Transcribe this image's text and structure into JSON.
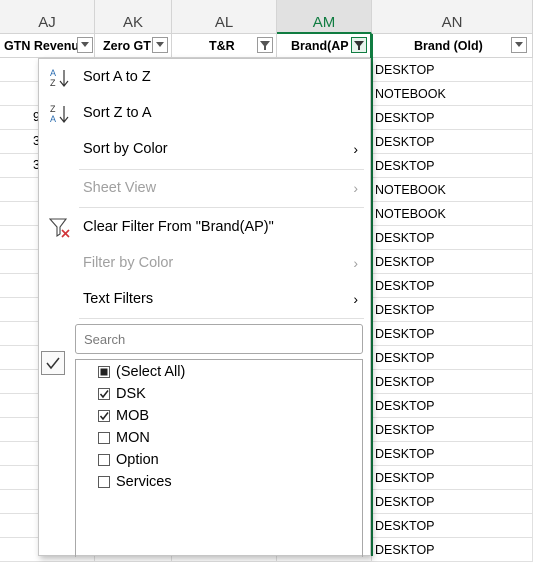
{
  "columns": [
    {
      "letter": "AJ",
      "header": "GTN Revenu",
      "active": false
    },
    {
      "letter": "AK",
      "header": "Zero GT",
      "active": false
    },
    {
      "letter": "AL",
      "header": "T&R",
      "active": false
    },
    {
      "letter": "AM",
      "header": "Brand(AP",
      "active": true
    },
    {
      "letter": "AN",
      "header": "Brand (Old)",
      "active": false
    }
  ],
  "brand_old_values": [
    "DESKTOP",
    "NOTEBOOK",
    "DESKTOP",
    "DESKTOP",
    "DESKTOP",
    "NOTEBOOK",
    "NOTEBOOK",
    "DESKTOP",
    "DESKTOP",
    "DESKTOP",
    "DESKTOP",
    "DESKTOP",
    "DESKTOP",
    "DESKTOP",
    "DESKTOP",
    "DESKTOP",
    "DESKTOP",
    "DESKTOP",
    "DESKTOP",
    "DESKTOP",
    "DESKTOP"
  ],
  "aj_fragments": [
    "9",
    "3",
    "3"
  ],
  "menu": {
    "sort_az": "Sort A to Z",
    "sort_za": "Sort Z to A",
    "sort_by_color": "Sort by Color",
    "sheet_view": "Sheet View",
    "clear_filter": "Clear Filter From \"Brand(AP)\"",
    "filter_by_color": "Filter by Color",
    "text_filters": "Text Filters",
    "chevron": "›",
    "search_placeholder": "Search",
    "items": [
      {
        "label": "(Select All)",
        "state": "partial"
      },
      {
        "label": "DSK",
        "state": "checked"
      },
      {
        "label": "MOB",
        "state": "checked"
      },
      {
        "label": "MON",
        "state": "unchecked"
      },
      {
        "label": "Option",
        "state": "unchecked"
      },
      {
        "label": "Services",
        "state": "unchecked"
      }
    ]
  },
  "colors": {
    "accent": "#107c41",
    "disabled": "#a0a0a0",
    "clear_x": "#d13438",
    "sort_blue": "#2b6cb0"
  }
}
